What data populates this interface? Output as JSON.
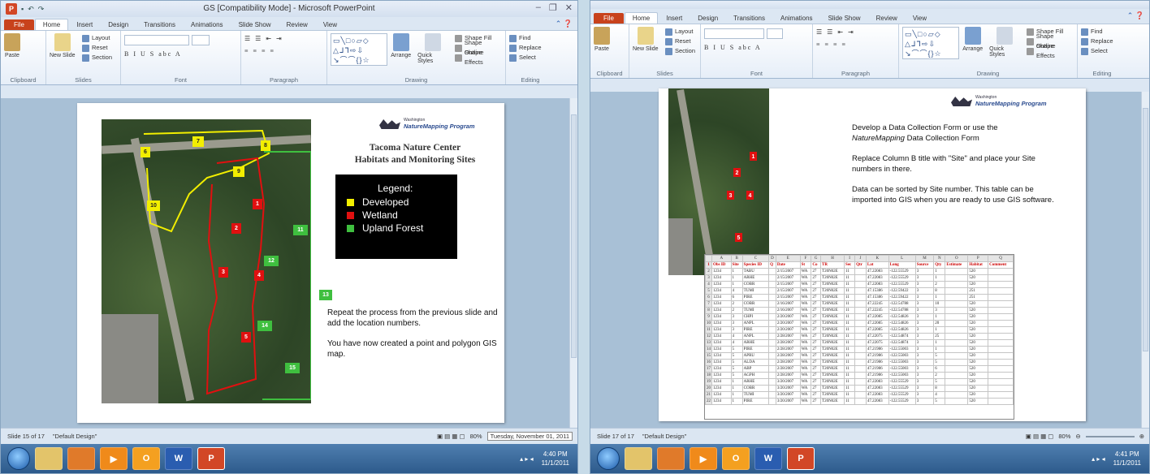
{
  "ribbon": {
    "tabs": [
      "File",
      "Home",
      "Insert",
      "Design",
      "Transitions",
      "Animations",
      "Slide Show",
      "Review",
      "View"
    ],
    "groups": [
      "Clipboard",
      "Slides",
      "Font",
      "Paragraph",
      "Drawing",
      "Editing"
    ],
    "paste": "Paste",
    "new_slide": "New Slide",
    "layout": "Layout",
    "reset": "Reset",
    "section": "Section",
    "arrange": "Arrange",
    "quick_styles": "Quick Styles",
    "shape_fill": "Shape Fill",
    "shape_outline": "Shape Outline",
    "shape_effects": "Shape Effects",
    "find": "Find",
    "replace": "Replace",
    "select": "Select"
  },
  "window1": {
    "title": "GS [Compatibility Mode] - Microsoft PowerPoint",
    "status_slide": "Slide 15 of 17",
    "status_theme": "\"Default Design\"",
    "zoom": "80%",
    "tooltip_date": "Tuesday, November 01, 2011",
    "clock_time": "4:40 PM",
    "clock_date": "11/1/2011"
  },
  "window2": {
    "status_slide": "Slide 17 of 17",
    "status_theme": "\"Default Design\"",
    "zoom": "80%",
    "clock_time": "4:41 PM",
    "clock_date": "11/1/2011"
  },
  "slide15": {
    "logo_small": "Washington",
    "logo_main": "NatureMapping Program",
    "title_line1": "Tacoma Nature Center",
    "title_line2": "Habitats and Monitoring Sites",
    "legend_title": "Legend:",
    "legend_items": [
      {
        "label": "Developed",
        "color": "#f2ee00"
      },
      {
        "label": "Wetland",
        "color": "#e01010"
      },
      {
        "label": "Upland Forest",
        "color": "#3fbf3f"
      }
    ],
    "para1": "Repeat the process from the previous slide and add the location numbers.",
    "para2": "You have now created a point and polygon GIS map.",
    "yellow_markers": [
      "6",
      "7",
      "8",
      "9",
      "10"
    ],
    "red_markers": [
      "1",
      "2",
      "3",
      "4",
      "5"
    ],
    "green_markers": [
      "11",
      "12",
      "13",
      "14",
      "15"
    ]
  },
  "slide17": {
    "logo_small": "Washington",
    "logo_main": "NatureMapping Program",
    "para1_a": "Develop a Data Collection Form or use the",
    "para1_b_italic": "NatureMapping",
    "para1_b_rest": " Data Collection Form",
    "para2": "Replace Column B title with \"Site\" and place your Site numbers in there.",
    "para3": "Data can be sorted by Site number.  This table can be imported into GIS when you are ready to use GIS software.",
    "red_markers": [
      "1",
      "2",
      "3",
      "4",
      "5"
    ],
    "sheet_columns": [
      "A",
      "B",
      "C",
      "D",
      "E",
      "F",
      "G",
      "H",
      "I",
      "J",
      "K",
      "L",
      "M",
      "N",
      "O",
      "P",
      "Q"
    ],
    "sheet_header": [
      "Obs ID",
      "Site",
      "Species ID",
      "Q",
      "Date",
      "St",
      "Co",
      "TR",
      "Sec",
      "Qtr",
      "Lat",
      "Long",
      "Source",
      "Qty",
      "Estimate",
      "Habitat",
      "Comment"
    ],
    "sheet_rows": [
      [
        "1234",
        "1",
        "TABU",
        "",
        "2/15/2007",
        "WA",
        "27",
        "T20N02E",
        "11",
        "",
        "47.22083",
        "-122.55529",
        "3",
        "1",
        "",
        "520",
        ""
      ],
      [
        "1234",
        "1",
        "ARHE",
        "",
        "2/15/2007",
        "WA",
        "27",
        "T20N02E",
        "11",
        "",
        "47.22083",
        "-122.55529",
        "3",
        "1",
        "",
        "520",
        ""
      ],
      [
        "1234",
        "1",
        "COBR",
        "",
        "2/15/2007",
        "WA",
        "27",
        "T20N02E",
        "11",
        "",
        "47.22083",
        "-122.55529",
        "3",
        "2",
        "",
        "520",
        ""
      ],
      [
        "1234",
        "4",
        "TUMI",
        "",
        "2/15/2007",
        "WA",
        "27",
        "T20N02E",
        "11",
        "",
        "47.15386",
        "-122.59422",
        "3",
        "8",
        "",
        "251",
        ""
      ],
      [
        "1234",
        "6",
        "PIRE",
        "",
        "2/15/2007",
        "WA",
        "27",
        "T20N02E",
        "11",
        "",
        "47.15386",
        "-122.59422",
        "3",
        "1",
        "",
        "251",
        ""
      ],
      [
        "1234",
        "2",
        "COBR",
        "",
        "2/16/2007",
        "WA",
        "27",
        "T20N02E",
        "11",
        "",
        "47.22245",
        "-122.54788",
        "3",
        "10",
        "",
        "520",
        ""
      ],
      [
        "1234",
        "2",
        "TUMI",
        "",
        "2/16/2007",
        "WA",
        "27",
        "T20N02E",
        "11",
        "",
        "47.22245",
        "-122.54788",
        "3",
        "3",
        "",
        "520",
        ""
      ],
      [
        "1234",
        "3",
        "CHPI",
        "",
        "2/20/2007",
        "WA",
        "27",
        "T20N02E",
        "11",
        "",
        "47.22085",
        "-122.54826",
        "3",
        "1",
        "",
        "520",
        ""
      ],
      [
        "1234",
        "3",
        "ANPL",
        "",
        "2/20/2007",
        "WA",
        "27",
        "T20N02E",
        "11",
        "",
        "47.22085",
        "-122.54826",
        "3",
        "20",
        "",
        "520",
        ""
      ],
      [
        "1234",
        "3",
        "PIRE",
        "",
        "2/20/2007",
        "WA",
        "27",
        "T20N02E",
        "11",
        "",
        "47.22085",
        "-122.54826",
        "3",
        "1",
        "",
        "520",
        ""
      ],
      [
        "1234",
        "4",
        "ANPL",
        "",
        "2/28/2007",
        "WA",
        "27",
        "T20N02E",
        "11",
        "",
        "47.22075",
        "-122.54874",
        "3",
        "25",
        "",
        "520",
        ""
      ],
      [
        "1234",
        "4",
        "ARHE",
        "",
        "2/28/2007",
        "WA",
        "27",
        "T20N02E",
        "11",
        "",
        "47.22075",
        "-122.54874",
        "3",
        "1",
        "",
        "520",
        ""
      ],
      [
        "1234",
        "5",
        "PIRE",
        "",
        "2/28/2007",
        "WA",
        "27",
        "T20N02E",
        "11",
        "",
        "47.21986",
        "-122.55003",
        "3",
        "1",
        "",
        "520",
        ""
      ],
      [
        "1234",
        "5",
        "APRU",
        "",
        "2/28/2007",
        "WA",
        "27",
        "T20N02E",
        "11",
        "",
        "47.21986",
        "-122.55003",
        "3",
        "5",
        "",
        "520",
        ""
      ],
      [
        "1234",
        "5",
        "ALDA",
        "",
        "2/28/2007",
        "WA",
        "27",
        "T20N02E",
        "11",
        "",
        "47.21986",
        "-122.55003",
        "3",
        "5",
        "",
        "520",
        ""
      ],
      [
        "1234",
        "5",
        "ABP",
        "",
        "2/28/2007",
        "WA",
        "27",
        "T20N02E",
        "11",
        "",
        "47.21986",
        "-122.55003",
        "3",
        "6",
        "",
        "520",
        ""
      ],
      [
        "1234",
        "5",
        "AGPH",
        "",
        "2/28/2007",
        "WA",
        "27",
        "T20N02E",
        "11",
        "",
        "47.21986",
        "-122.55003",
        "3",
        "2",
        "",
        "520",
        ""
      ],
      [
        "1234",
        "1",
        "ARHE",
        "",
        "3/20/2007",
        "WA",
        "27",
        "T20N02E",
        "11",
        "",
        "47.22083",
        "-122.55529",
        "3",
        "5",
        "",
        "520",
        ""
      ],
      [
        "1234",
        "1",
        "COBR",
        "",
        "3/20/2007",
        "WA",
        "27",
        "T20N02E",
        "11",
        "",
        "47.22083",
        "-122.55529",
        "3",
        "8",
        "",
        "520",
        ""
      ],
      [
        "1234",
        "1",
        "TUMI",
        "",
        "3/20/2007",
        "WA",
        "27",
        "T20N02E",
        "11",
        "",
        "47.22083",
        "-122.55529",
        "3",
        "4",
        "",
        "520",
        ""
      ],
      [
        "1234",
        "1",
        "PIRE",
        "",
        "3/20/2007",
        "WA",
        "27",
        "T20N02E",
        "11",
        "",
        "47.22083",
        "-122.55529",
        "3",
        "5",
        "",
        "520",
        ""
      ]
    ]
  }
}
